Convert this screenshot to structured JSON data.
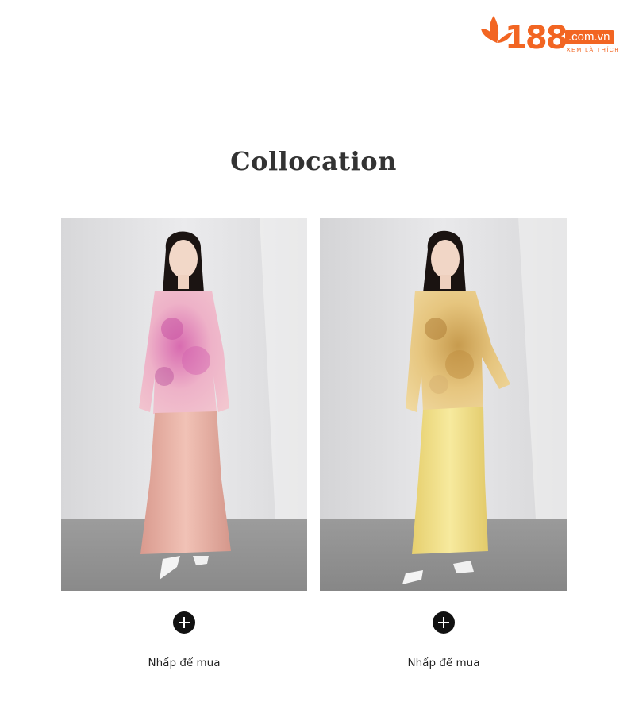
{
  "logo": {
    "number": "188",
    "domain": ".com.vn",
    "tagline": "XEM LÀ THÍCH",
    "brand_color": "#f26522"
  },
  "section": {
    "title": "Collocation"
  },
  "products": [
    {
      "image_desc": "model in pink floral top and pink satin skirt",
      "add_icon": "plus-circle-icon",
      "buy_label": "Nhấp để mua",
      "top_color": "#e9a9c2",
      "skirt_color": "#e8b3a6"
    },
    {
      "image_desc": "model in yellow floral top and yellow satin skirt",
      "add_icon": "plus-circle-icon",
      "buy_label": "Nhấp để mua",
      "top_color": "#e2c27a",
      "skirt_color": "#f1df8e"
    }
  ]
}
